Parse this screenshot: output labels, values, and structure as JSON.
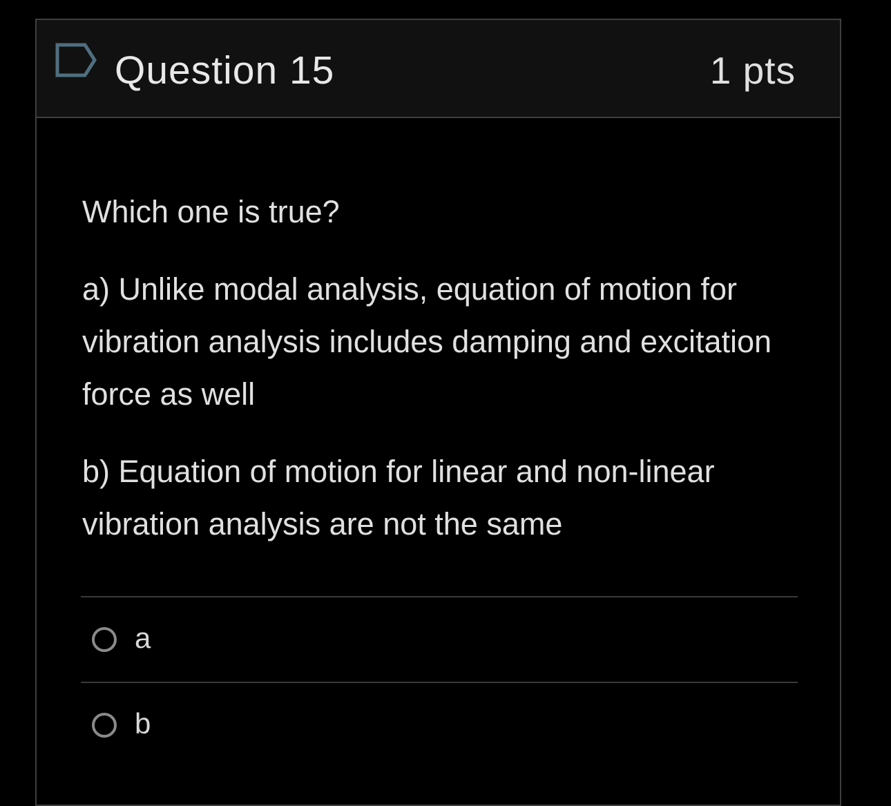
{
  "question": {
    "title": "Question 15",
    "points": "1 pts",
    "flag_icon": "flag-outline-icon",
    "prompt": "Which one is true?",
    "statements": [
      "a)  Unlike modal analysis, equation of motion for vibration analysis includes damping and excitation force as well",
      "b)  Equation of motion for linear and non-linear vibration analysis are not the same"
    ],
    "answers": [
      {
        "label": "a",
        "selected": false
      },
      {
        "label": "b",
        "selected": false
      }
    ]
  },
  "colors": {
    "background": "#000000",
    "header_background": "#111111",
    "border": "#3f3f3f",
    "text": "#e0e0e0",
    "radio_border": "#8a8a8a",
    "flag_stroke": "#4f6f80"
  }
}
